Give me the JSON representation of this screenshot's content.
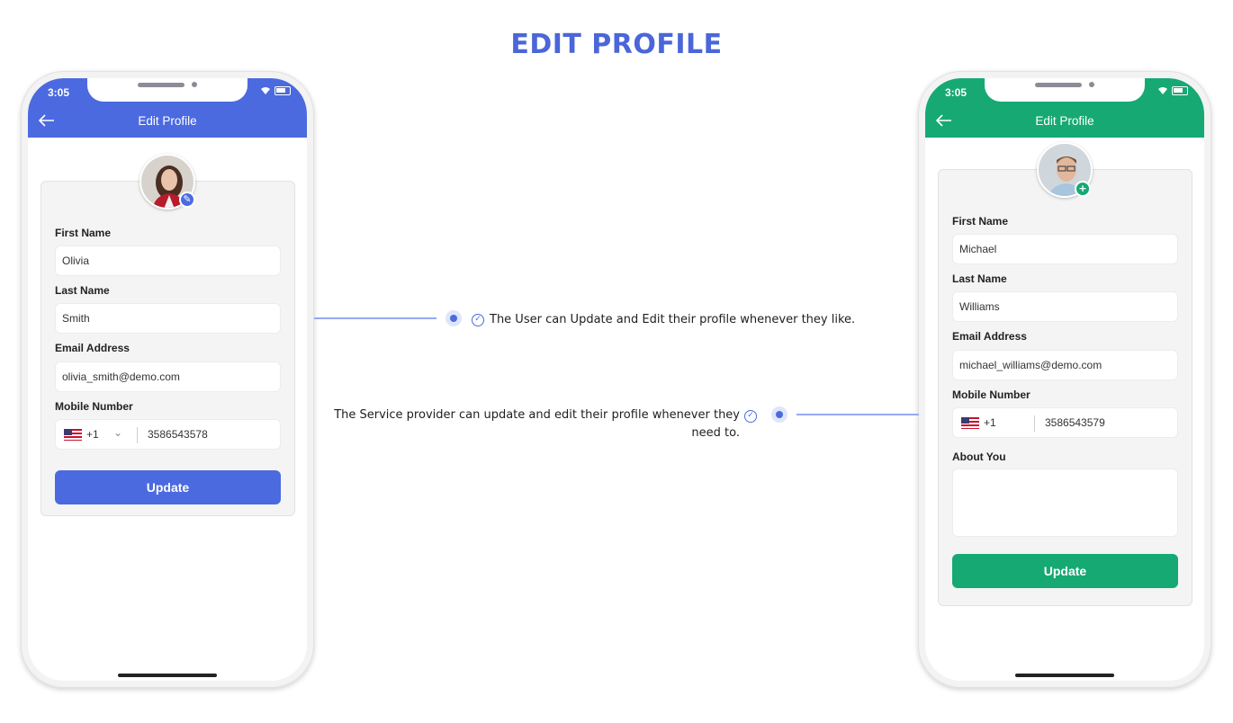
{
  "page": {
    "title": "EDIT PROFILE"
  },
  "colors": {
    "accent_blue": "#4b6ae0",
    "accent_green": "#16a974",
    "title_blue": "#4b66d8"
  },
  "left_phone": {
    "status_time": "3:05",
    "header_title": "Edit Profile",
    "avatar_badge_icon": "pencil-icon",
    "fields": {
      "first_name_label": "First Name",
      "first_name_value": "Olivia",
      "last_name_label": "Last Name",
      "last_name_value": "Smith",
      "email_label": "Email Address",
      "email_value": "olivia_smith@demo.com",
      "mobile_label": "Mobile Number",
      "dial_code": "+1",
      "mobile_value": "3586543578"
    },
    "update_label": "Update"
  },
  "right_phone": {
    "status_time": "3:05",
    "header_title": "Edit Profile",
    "avatar_badge_icon": "plus-icon",
    "fields": {
      "first_name_label": "First Name",
      "first_name_value": "Michael",
      "last_name_label": "Last Name",
      "last_name_value": "Williams",
      "email_label": "Email Address",
      "email_value": "michael_williams@demo.com",
      "mobile_label": "Mobile Number",
      "dial_code": "+1",
      "mobile_value": "3586543579",
      "about_label": "About You",
      "about_value": ""
    },
    "update_label": "Update"
  },
  "callouts": {
    "user": "The User can Update and Edit their profile whenever they like.",
    "provider_line1": "The Service provider can update and edit their profile whenever they",
    "provider_line2": "need to."
  }
}
